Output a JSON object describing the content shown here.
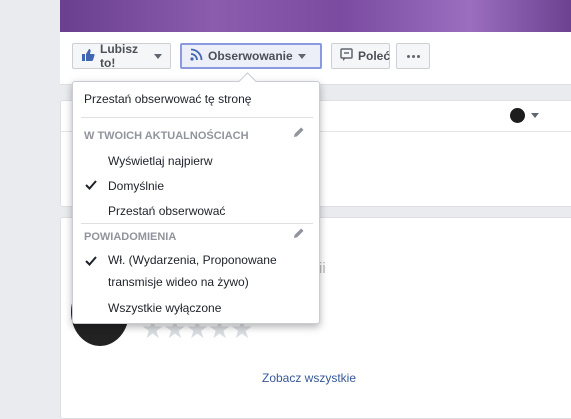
{
  "action_bar": {
    "like_label": "Lubisz to!",
    "follow_label": "Obserwowanie",
    "share_label": "Poleć"
  },
  "dropdown": {
    "unfollow_page": "Przestań obserwować tę stronę",
    "news_feed_section": "W TWOICH AKTUALNOŚCIACH",
    "see_first": "Wyświetlaj najpierw",
    "default": "Domyślnie",
    "unfollow": "Przestań obserwować",
    "notifications_section": "POWIADOMIENIA",
    "on_line1": "Wł. (Wydarzenia, Proponowane",
    "on_line2": "transmisje wideo na żywo)",
    "all_off": "Wszystkie wyłączone"
  },
  "card2": {
    "faded_text": "ii",
    "stars": "★★★★★"
  },
  "footer": {
    "see_all": "Zobacz wszystkie"
  },
  "colors": {
    "link": "#365899",
    "focus_border": "#8b9ae0"
  },
  "icons": {
    "like": "thumbs-up-icon",
    "follow": "rss-icon",
    "share": "share-icon",
    "more": "more-dots-icon",
    "edit": "pencil-icon",
    "check": "checkmark-icon"
  }
}
